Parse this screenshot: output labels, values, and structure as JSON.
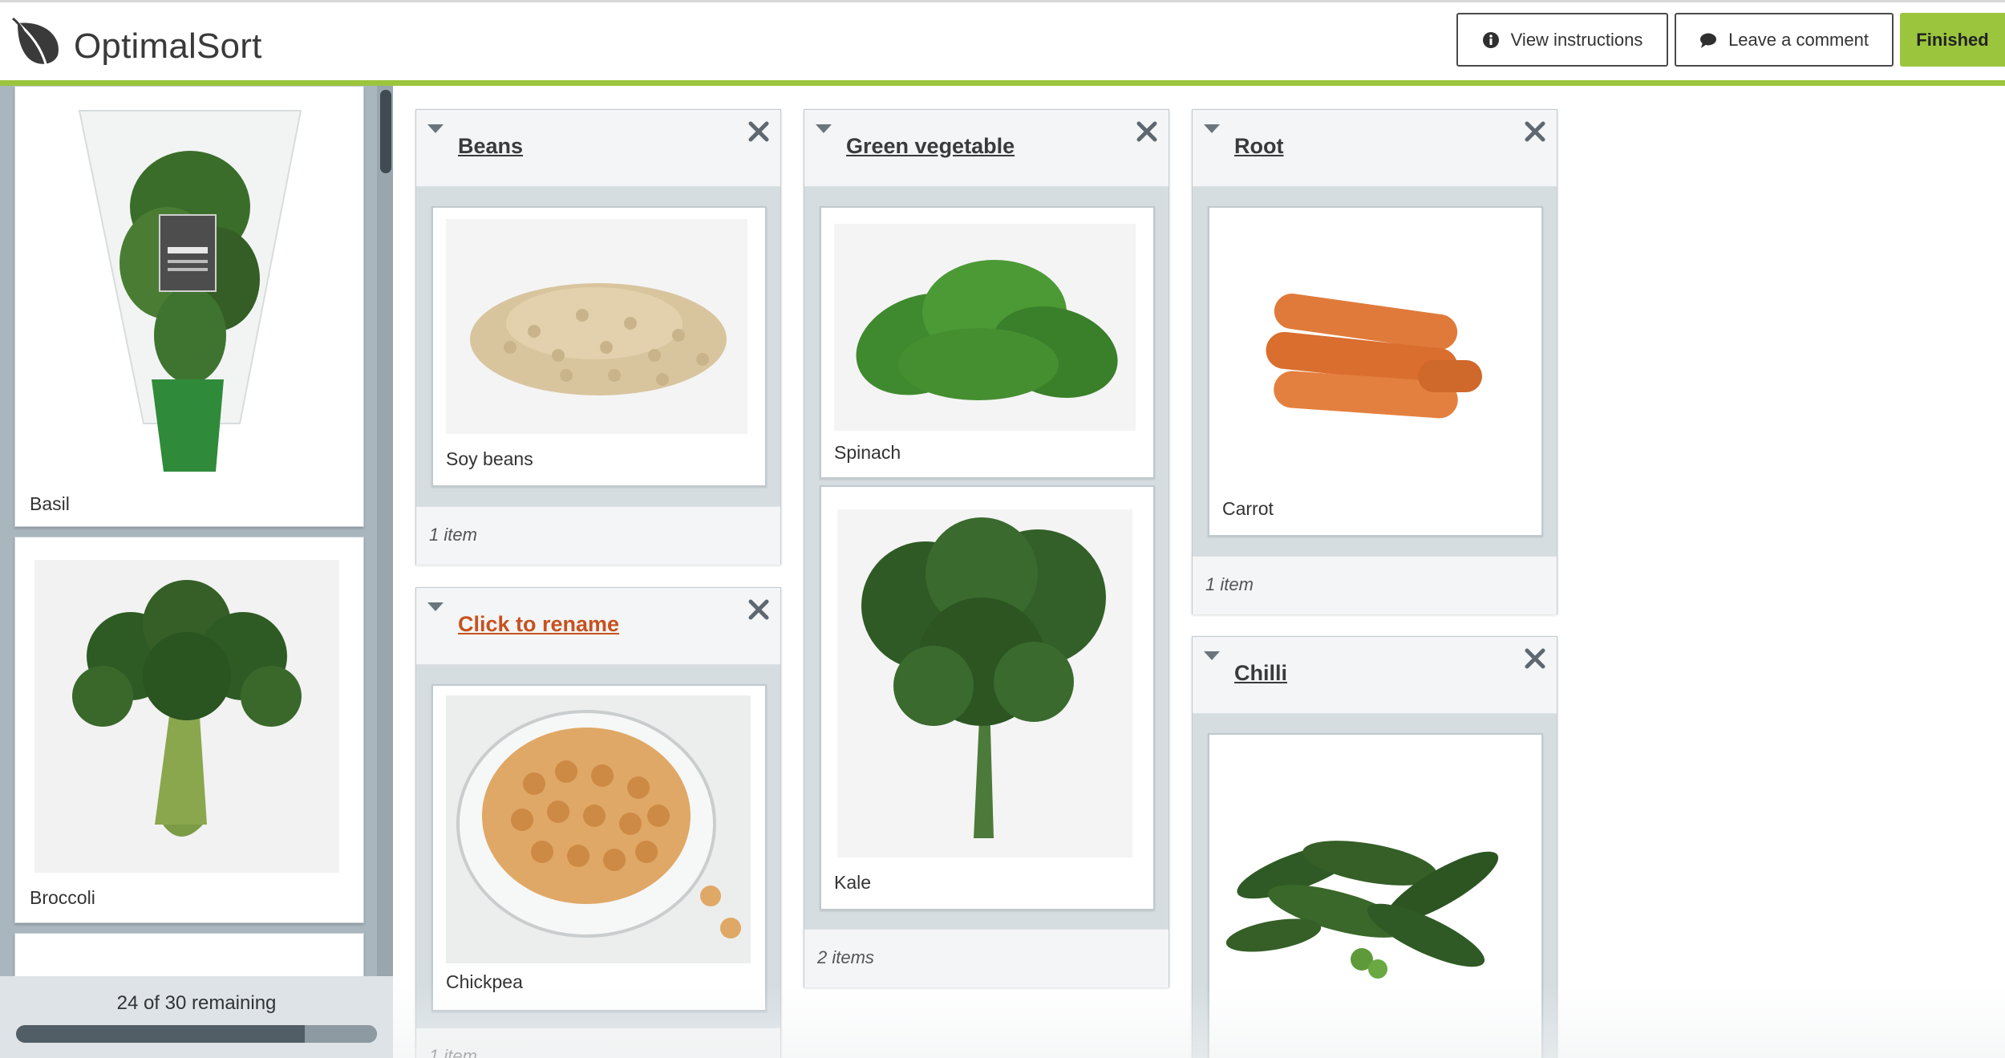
{
  "app": {
    "name": "OptimalSort",
    "brand_color": "#9bc53d",
    "rename_color": "#c7511f"
  },
  "header": {
    "view_instructions_label": "View instructions",
    "view_instructions_icon": "info-icon",
    "leave_comment_label": "Leave a comment",
    "leave_comment_icon": "speech-bubble-icon",
    "finished_label": "Finished"
  },
  "cards": {
    "items": [
      {
        "label": "Basil",
        "image": "basil-photo"
      },
      {
        "label": "Broccoli",
        "image": "broccoli-photo"
      },
      {
        "label": "",
        "image": "next-card-partial"
      }
    ],
    "remaining_text": "24 of 30 remaining",
    "sorted_fraction": 0.2
  },
  "groups": [
    {
      "title": "Beans",
      "cards": [
        {
          "label": "Soy beans",
          "image": "soy-beans-photo"
        }
      ],
      "count": "1 item"
    },
    {
      "title": "Click to rename",
      "cards": [
        {
          "label": "Chickpea",
          "image": "chickpea-photo"
        }
      ],
      "count": "1 item"
    },
    {
      "title": "Green vegetable",
      "cards": [
        {
          "label": "Spinach",
          "image": "spinach-photo"
        },
        {
          "label": "Kale",
          "image": "kale-photo"
        }
      ],
      "count": "2 items"
    },
    {
      "title": "Root",
      "cards": [
        {
          "label": "Carrot",
          "image": "carrot-photo"
        }
      ],
      "count": "1 item"
    },
    {
      "title": "Chilli",
      "cards": [
        {
          "label": "",
          "image": "chilli-photo"
        }
      ],
      "count": ""
    }
  ]
}
